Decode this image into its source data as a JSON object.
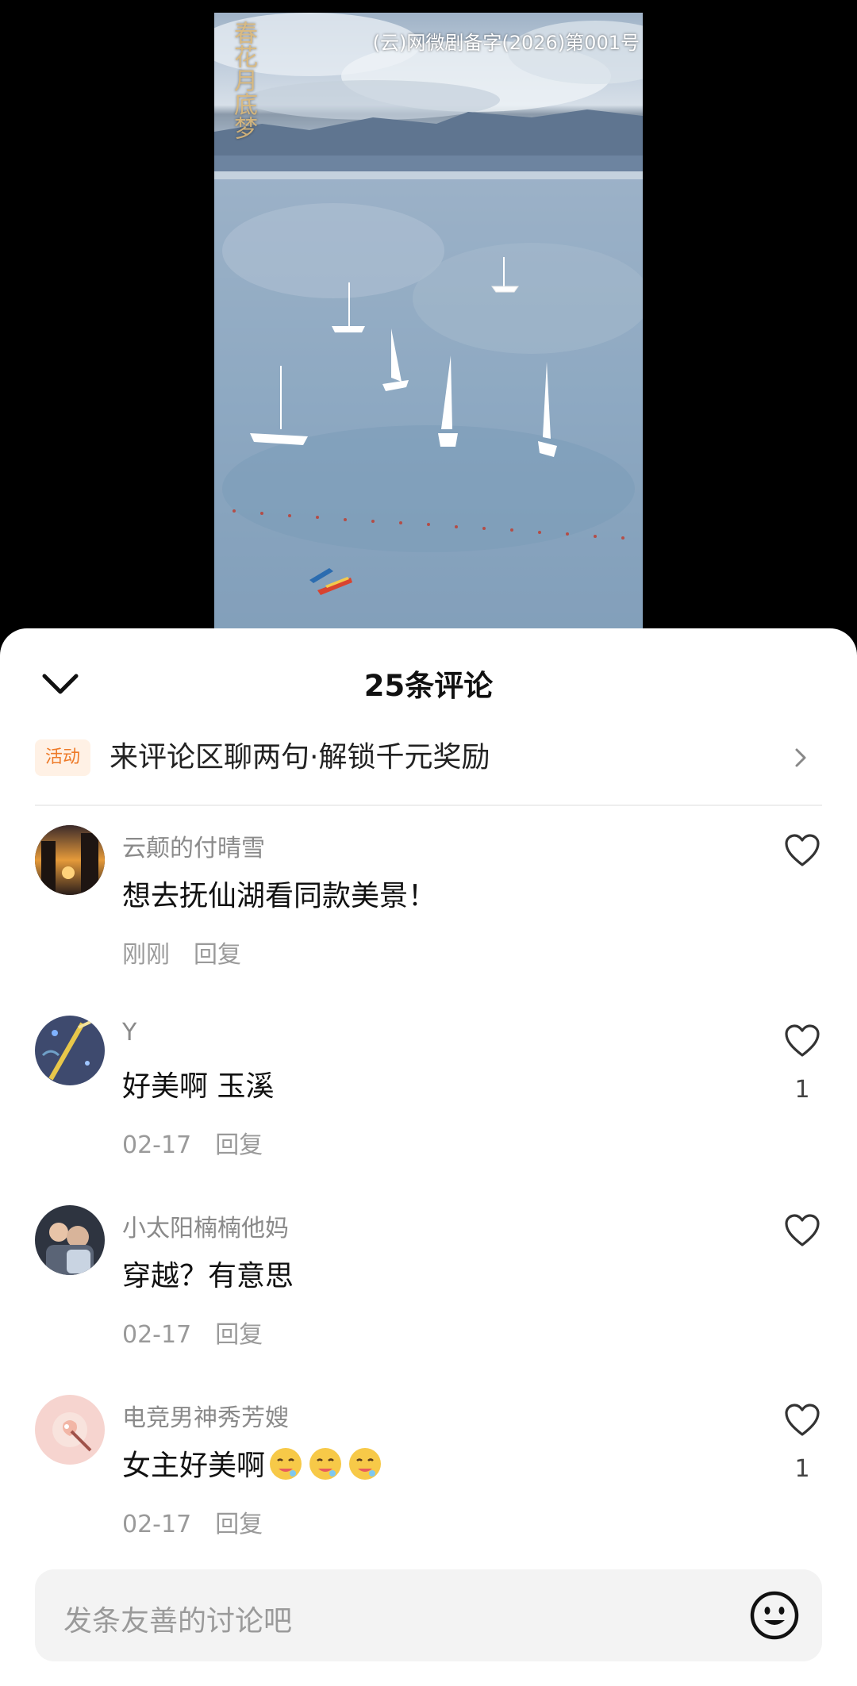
{
  "video": {
    "watermark": "(云)网微剧备字(2026)第001号",
    "title_art": "春花月底梦",
    "scene": "aerial lake with sailboats"
  },
  "sheet": {
    "title": "25条评论",
    "collapse_icon": "chevron-down-icon",
    "promo": {
      "badge": "活动",
      "text": "来评论区聊两句·解锁千元奖励",
      "arrow_icon": "chevron-right-icon"
    }
  },
  "comments": [
    {
      "user": "云颠的付晴雪",
      "text": "想去抚仙湖看同款美景！",
      "time": "刚刚",
      "reply": "回复",
      "likes": ""
    },
    {
      "user": "Y",
      "text": "好美啊 玉溪",
      "time": "02-17",
      "reply": "回复",
      "likes": "1"
    },
    {
      "user": "小太阳楠楠他妈",
      "text": "穿越？有意思",
      "time": "02-17",
      "reply": "回复",
      "likes": ""
    },
    {
      "user": "电竞男神秀芳嫂",
      "text": "女主好美啊",
      "emoji": "drooling-face-emoji",
      "emoji_count": 3,
      "time": "02-17",
      "reply": "回复",
      "likes": "1"
    }
  ],
  "input": {
    "placeholder": "发条友善的讨论吧",
    "emoji_icon": "smiley-icon"
  },
  "colors": {
    "promo_badge_text": "#ee7a28",
    "promo_badge_bg": "#fff1e5",
    "sheet_bg": "#ffffff",
    "page_bg": "#000000"
  }
}
